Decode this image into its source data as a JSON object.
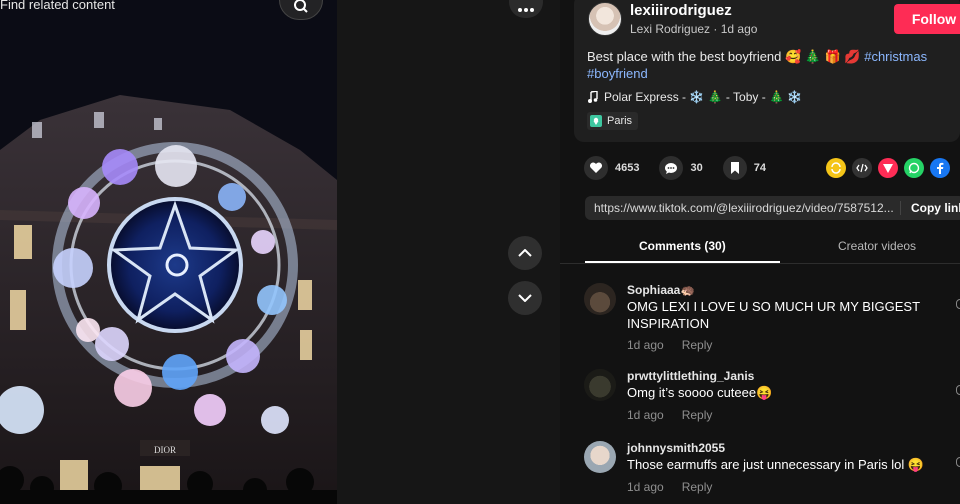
{
  "video": {
    "search_text": "Find related content",
    "search_icon": "search-icon",
    "more_icon": "more-icon",
    "nav_up_icon": "chevron-up-icon",
    "nav_down_icon": "chevron-down-icon",
    "storefront_text": "DIOR"
  },
  "author": {
    "username": "lexiiirodriguez",
    "nickname": "Lexi Rodriguez",
    "posted": "1d ago",
    "follow_label": "Follow"
  },
  "caption": {
    "text": "Best place with the best boyfriend 🥰 🎄 🎁 💋",
    "tags": [
      "#christmas",
      "#boyfriend"
    ]
  },
  "music": {
    "icon": "music-note-icon",
    "title": "Polar Express - ❄️ 🎄 - Toby - 🎄 ❄️"
  },
  "location": {
    "icon": "location-pin-icon",
    "label": "Paris"
  },
  "stats": {
    "likes": "4653",
    "comments": "30",
    "saves": "74"
  },
  "share": {
    "items": [
      "repost-icon",
      "embed-icon",
      "send-icon",
      "whatsapp-icon",
      "facebook-icon"
    ],
    "colors": [
      "#f5c518",
      "#333333",
      "#fe2c55",
      "#25d366",
      "#1877f2"
    ]
  },
  "link": {
    "url": "https://www.tiktok.com/@lexiiirodriguez/video/7587512...",
    "copy_label": "Copy link"
  },
  "tabs": {
    "comments": "Comments (30)",
    "creator": "Creator videos"
  },
  "comments": [
    {
      "user": "Sophiaaa🦔",
      "text": "OMG LEXI I LOVE U SO MUCH UR MY BIGGEST INSPIRATION",
      "time": "1d ago",
      "reply": "Reply"
    },
    {
      "user": "prwttylittlething_Janis",
      "text": "Omg it’s soooo cuteee😝",
      "time": "1d ago",
      "reply": "Reply"
    },
    {
      "user": "johnnysmith2055",
      "text": "Those earmuffs are just unnecessary in Paris lol 😝",
      "time": "1d ago",
      "reply": "Reply"
    }
  ]
}
